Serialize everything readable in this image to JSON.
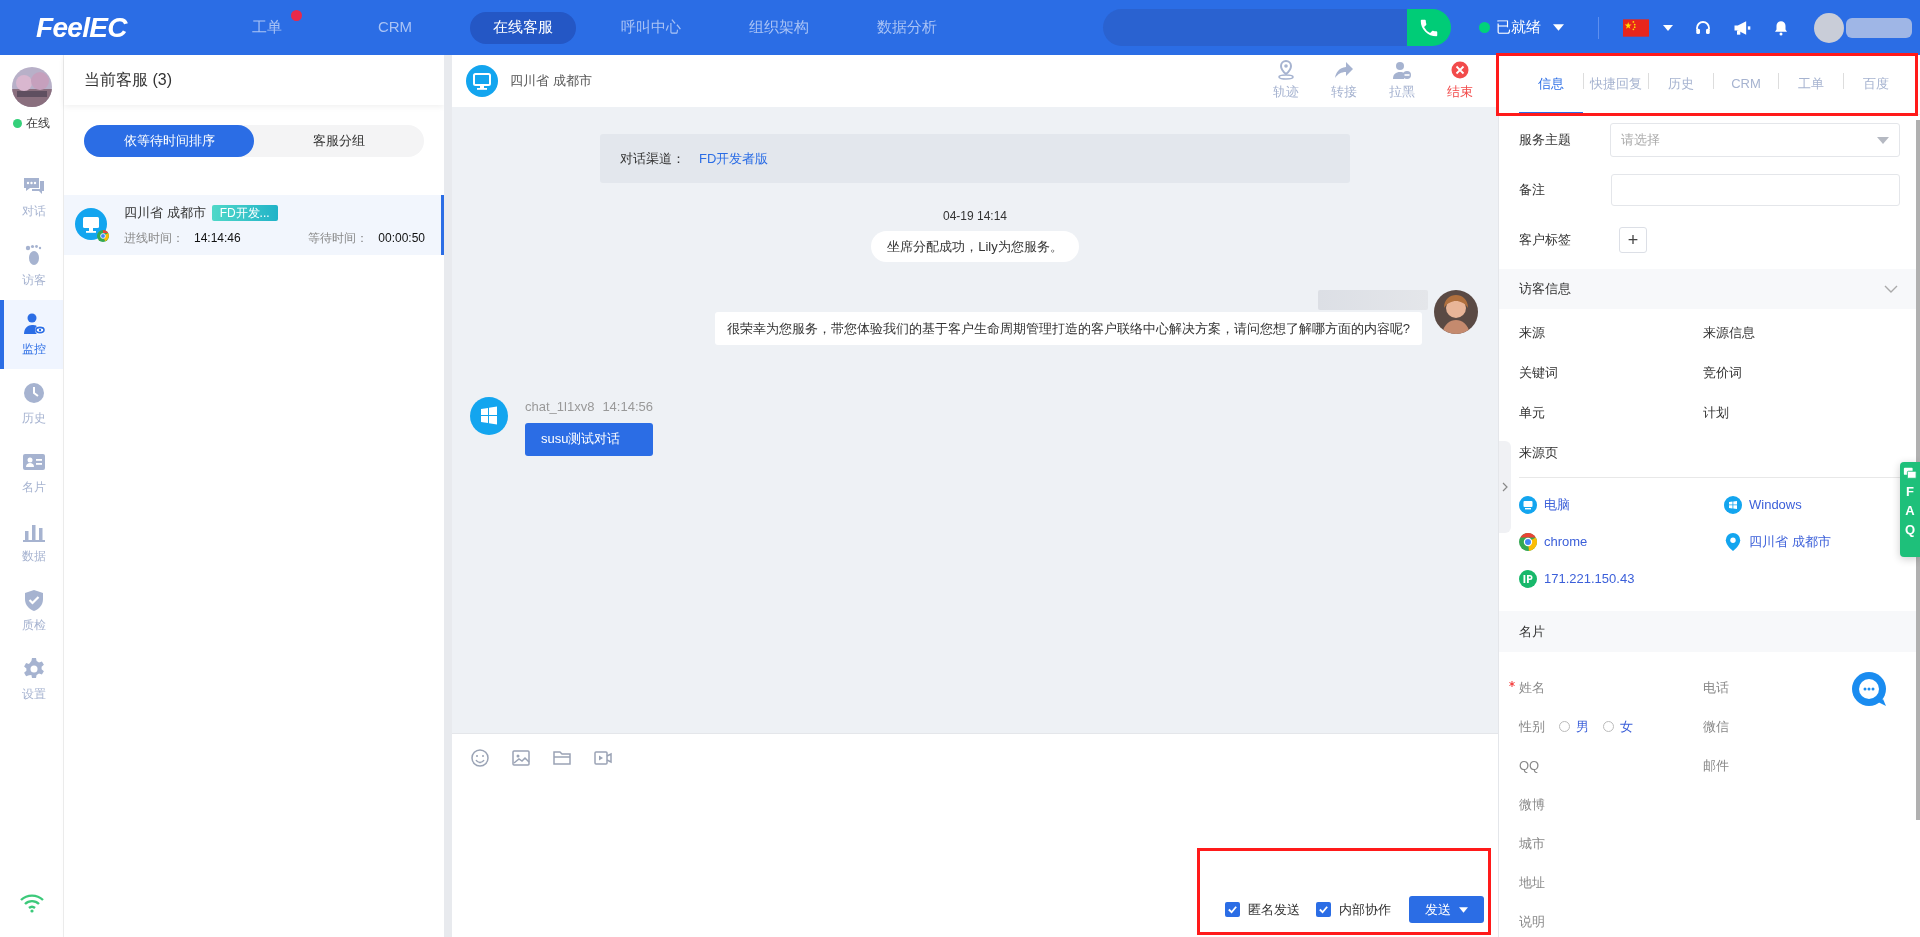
{
  "topbar": {
    "logo": "FeelEC",
    "nav": [
      {
        "label": "工单",
        "selected": false,
        "badge": true
      },
      {
        "label": "CRM",
        "selected": false,
        "badge": false
      },
      {
        "label": "在线客服",
        "selected": true,
        "badge": false
      },
      {
        "label": "呼叫中心",
        "selected": false,
        "badge": false
      },
      {
        "label": "组织架构",
        "selected": false,
        "badge": false
      },
      {
        "label": "数据分析",
        "selected": false,
        "badge": false
      }
    ],
    "status": "已就绪"
  },
  "sidebar": {
    "status": "在线",
    "items": [
      {
        "label": "对话",
        "selected": false
      },
      {
        "label": "访客",
        "selected": false
      },
      {
        "label": "监控",
        "selected": true
      },
      {
        "label": "历史",
        "selected": false
      },
      {
        "label": "名片",
        "selected": false
      },
      {
        "label": "数据",
        "selected": false
      },
      {
        "label": "质检",
        "selected": false
      },
      {
        "label": "设置",
        "selected": false
      }
    ]
  },
  "queue": {
    "title": "当前客服 (3)",
    "sort_tabs": [
      {
        "label": "依等待时间排序",
        "selected": true
      },
      {
        "label": "客服分组",
        "selected": false
      }
    ],
    "sessions": [
      {
        "location": "四川省 成都市",
        "tag": "FD开发...",
        "entry_label": "进线时间：",
        "entry_time": "14:14:46",
        "wait_label": "等待时间：",
        "wait_time": "00:00:50",
        "selected": true
      }
    ]
  },
  "chat": {
    "title": "四川省 成都市",
    "actions": [
      {
        "label": "轨迹",
        "kind": "track"
      },
      {
        "label": "转接",
        "kind": "transfer"
      },
      {
        "label": "拉黑",
        "kind": "block"
      },
      {
        "label": "结束",
        "kind": "end"
      }
    ],
    "channel_label": "对话渠道：",
    "channel": "FD开发者版",
    "messages": [
      {
        "kind": "time",
        "text": "04-19 14:14"
      },
      {
        "kind": "system",
        "text": "坐席分配成功，Lily为您服务。"
      },
      {
        "kind": "agent",
        "text": "很荣幸为您服务，带您体验我们的基于客户生命周期管理打造的客户联络中心解决方案，请问您想了解哪方面的内容呢?"
      },
      {
        "kind": "visitor",
        "sender": "chat_1l1xv8",
        "time": "14:14:56",
        "text": "susu测试对话"
      }
    ],
    "composer": {
      "options": [
        {
          "label": "匿名发送",
          "checked": true
        },
        {
          "label": "内部协作",
          "checked": true
        }
      ],
      "send": "发送"
    }
  },
  "info_panel": {
    "tabs": [
      {
        "label": "信息",
        "selected": true
      },
      {
        "label": "快捷回复",
        "selected": false
      },
      {
        "label": "历史",
        "selected": false
      },
      {
        "label": "CRM",
        "selected": false
      },
      {
        "label": "工单",
        "selected": false
      },
      {
        "label": "百度",
        "selected": false
      }
    ],
    "form": [
      {
        "label": "服务主题",
        "kind": "select",
        "placeholder": "请选择"
      },
      {
        "label": "备注",
        "kind": "input"
      },
      {
        "label": "客户标签",
        "kind": "tags",
        "button": "+"
      }
    ],
    "visitor_section": "访客信息",
    "visitor_fields": [
      "来源",
      "来源信息",
      "关键词",
      "竞价词",
      "单元",
      "计划",
      "来源页"
    ],
    "device": [
      {
        "kind": "pc",
        "text": "电脑"
      },
      {
        "kind": "windows",
        "text": "Windows"
      },
      {
        "kind": "chrome",
        "text": "chrome"
      },
      {
        "kind": "location",
        "text": "四川省 成都市"
      },
      {
        "kind": "ip",
        "text": "171.221.150.43"
      }
    ],
    "card_section": "名片",
    "card_rows": [
      {
        "cells": [
          {
            "label": "姓名",
            "required": true
          },
          {
            "label": "电话",
            "required": false
          }
        ]
      },
      {
        "cells": [
          {
            "label": "性别",
            "required": false,
            "options": [
              {
                "label": "男",
                "selected": false
              },
              {
                "label": "女",
                "selected": false
              }
            ]
          },
          {
            "label": "微信",
            "required": false
          }
        ]
      },
      {
        "cells": [
          {
            "label": "QQ",
            "required": false
          },
          {
            "label": "邮件",
            "required": false
          }
        ]
      },
      {
        "cells": [
          {
            "label": "微博",
            "required": false
          }
        ]
      },
      {
        "cells": [
          {
            "label": "城市",
            "required": false
          }
        ]
      },
      {
        "cells": [
          {
            "label": "地址",
            "required": false
          }
        ]
      },
      {
        "cells": [
          {
            "label": "说明",
            "required": false
          }
        ]
      }
    ]
  },
  "faq_tab": [
    "F",
    "A",
    "Q"
  ]
}
